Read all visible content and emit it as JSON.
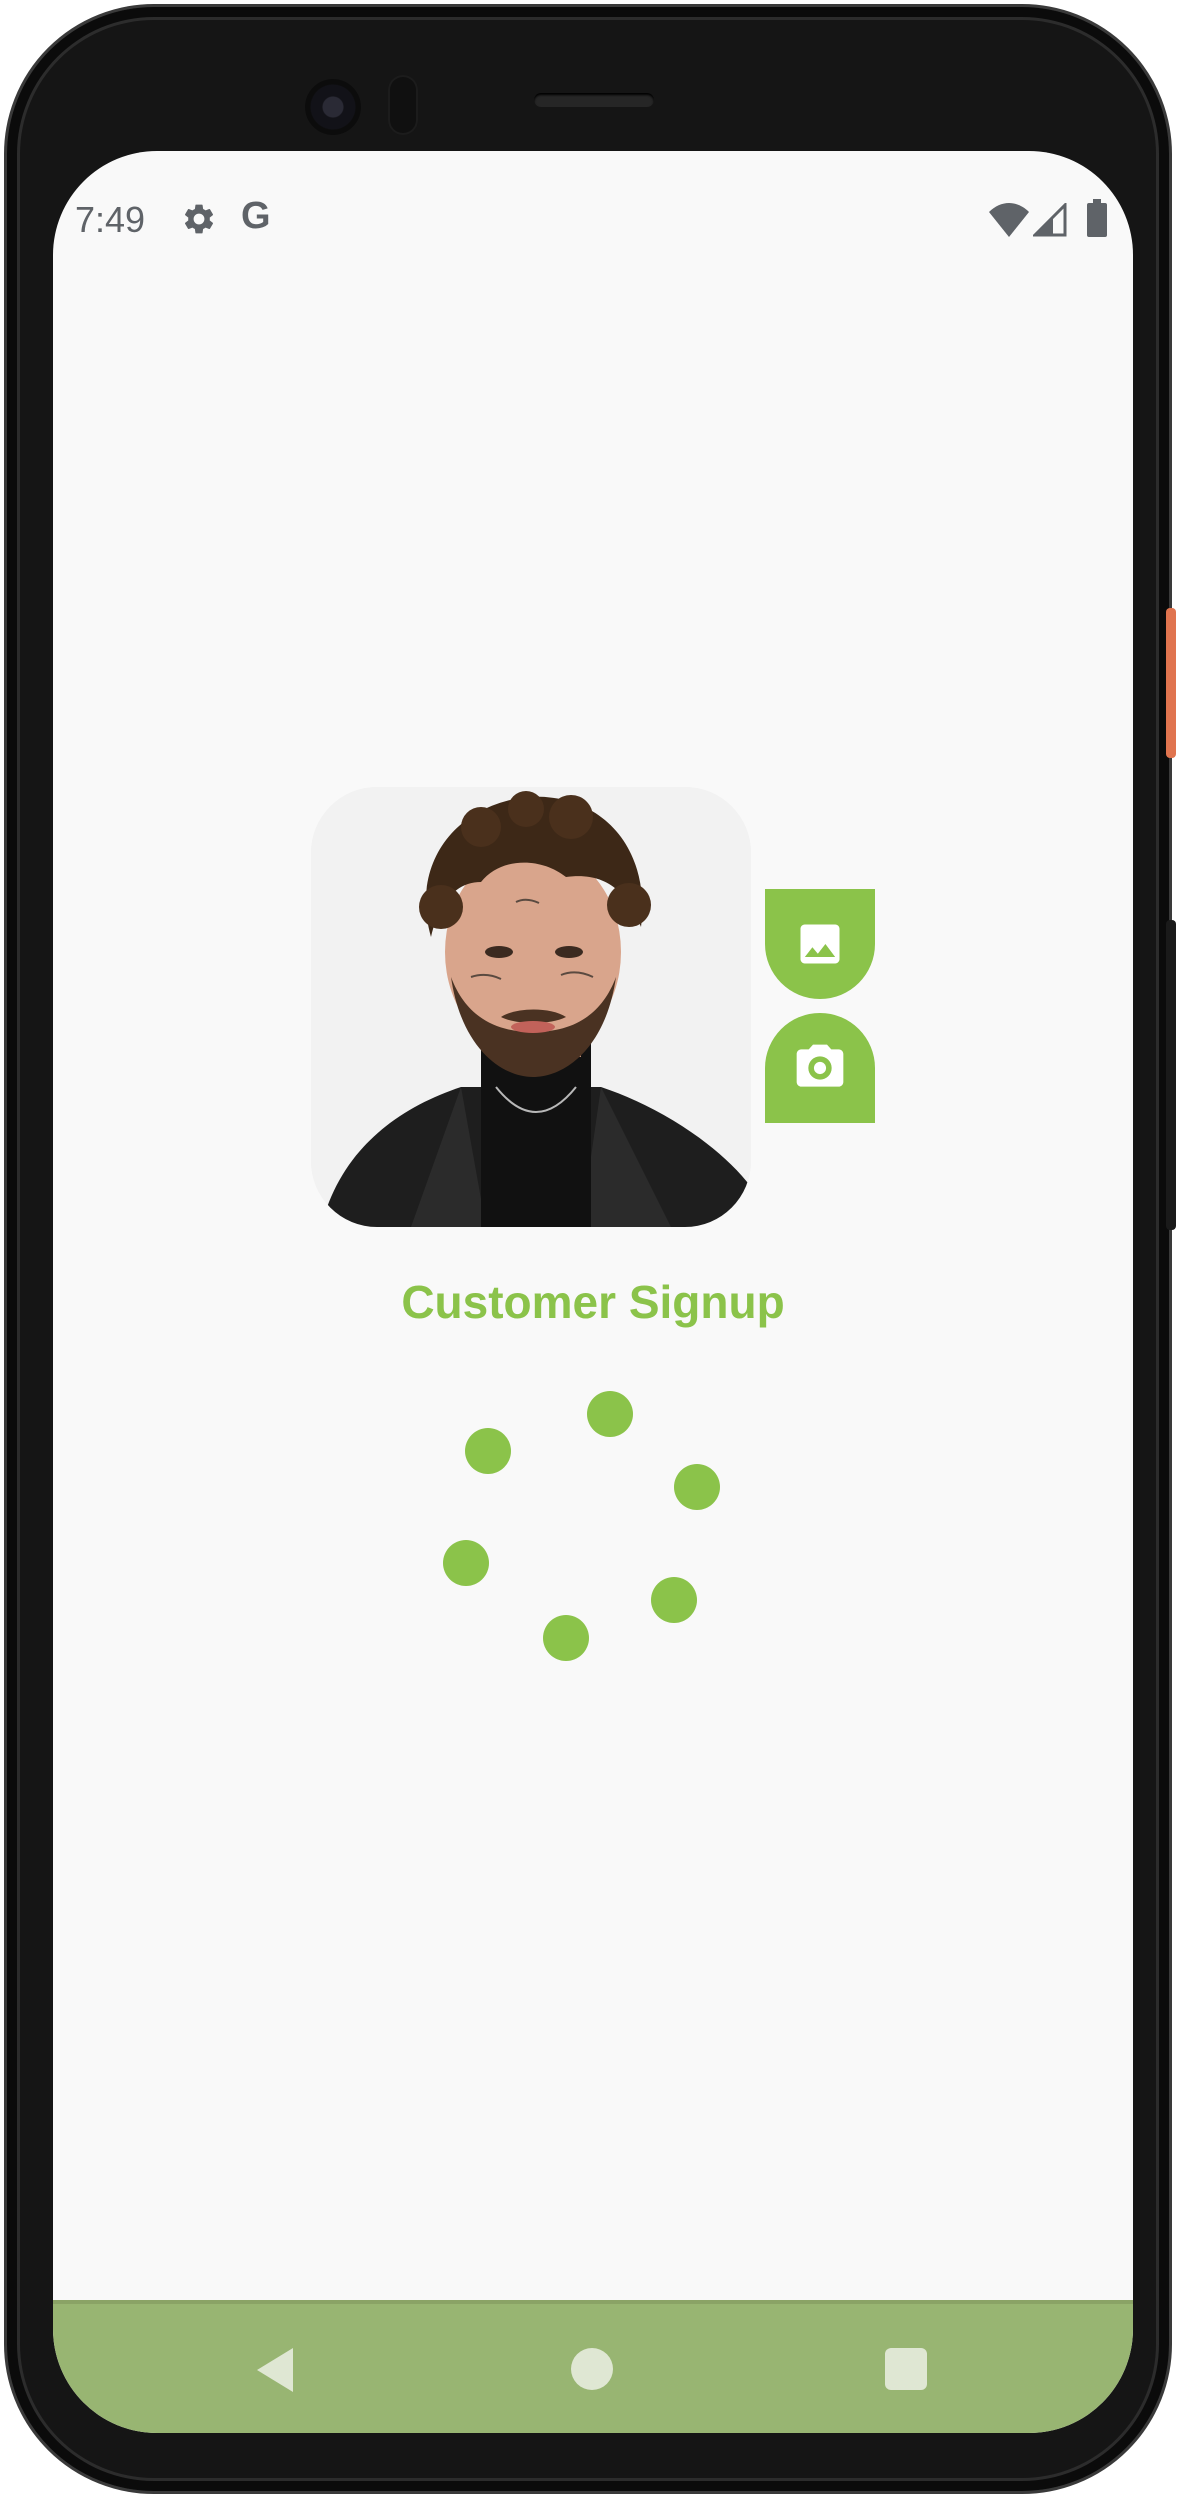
{
  "status_bar": {
    "time": "7:49",
    "notification_icons": [
      "settings-icon",
      "google-icon"
    ],
    "google_letter": "G",
    "system_icons": [
      "wifi-icon",
      "signal-icon",
      "battery-icon"
    ]
  },
  "profile": {
    "image_alt": "Profile photo",
    "actions": [
      {
        "name": "gallery-button",
        "icon": "image-icon"
      },
      {
        "name": "camera-button",
        "icon": "camera-icon"
      }
    ]
  },
  "page": {
    "title": "Customer Signup"
  },
  "loading": {
    "indicator": "loading-spinner"
  },
  "navigation": {
    "buttons": [
      "back",
      "home",
      "recents"
    ]
  },
  "colors": {
    "accent": "#8bc34a",
    "nav_bar": "#98b572",
    "background": "#f9f9f9"
  }
}
